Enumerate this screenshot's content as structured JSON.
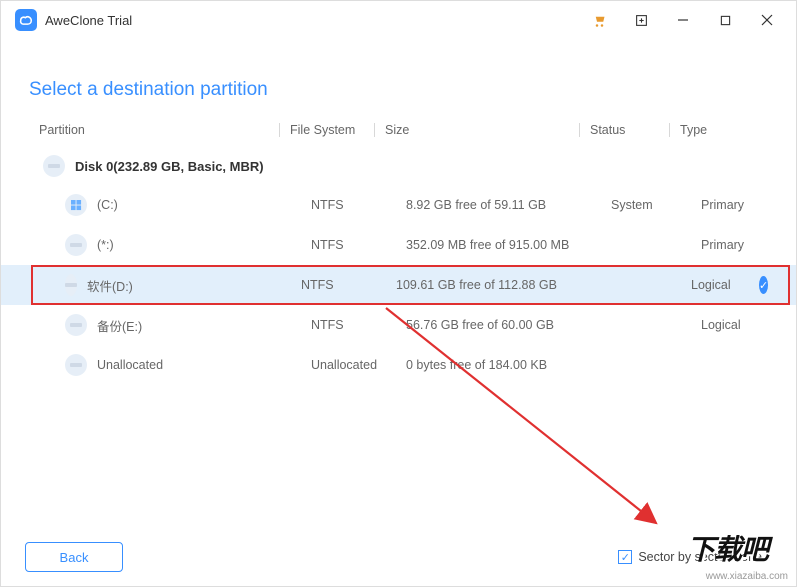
{
  "app": {
    "title": "AweClone Trial"
  },
  "page": {
    "title": "Select a destination partition"
  },
  "columns": {
    "partition": "Partition",
    "fileSystem": "File System",
    "size": "Size",
    "status": "Status",
    "type": "Type"
  },
  "disk": {
    "label": "Disk 0(232.89 GB, Basic, MBR)"
  },
  "partitions": [
    {
      "name": "(C:)",
      "fs": "NTFS",
      "size": "8.92 GB free of 59.11 GB",
      "status": "System",
      "type": "Primary",
      "iconKind": "win",
      "selected": false
    },
    {
      "name": "(*:)",
      "fs": "NTFS",
      "size": "352.09 MB free of 915.00 MB",
      "status": "",
      "type": "Primary",
      "iconKind": "disk",
      "selected": false
    },
    {
      "name": "软件(D:)",
      "fs": "NTFS",
      "size": "109.61 GB free of 112.88 GB",
      "status": "",
      "type": "Logical",
      "iconKind": "disk",
      "selected": true
    },
    {
      "name": "备份(E:)",
      "fs": "NTFS",
      "size": "56.76 GB free of 60.00 GB",
      "status": "",
      "type": "Logical",
      "iconKind": "disk",
      "selected": false
    },
    {
      "name": "Unallocated",
      "fs": "Unallocated",
      "size": "0 bytes free of 184.00 KB",
      "status": "",
      "type": "",
      "iconKind": "disk",
      "selected": false
    }
  ],
  "footer": {
    "back": "Back",
    "sectorLabel": "Sector by sector clone",
    "sectorChecked": true
  },
  "watermark": {
    "chars": "下载吧",
    "url": "www.xiazaiba.com"
  }
}
